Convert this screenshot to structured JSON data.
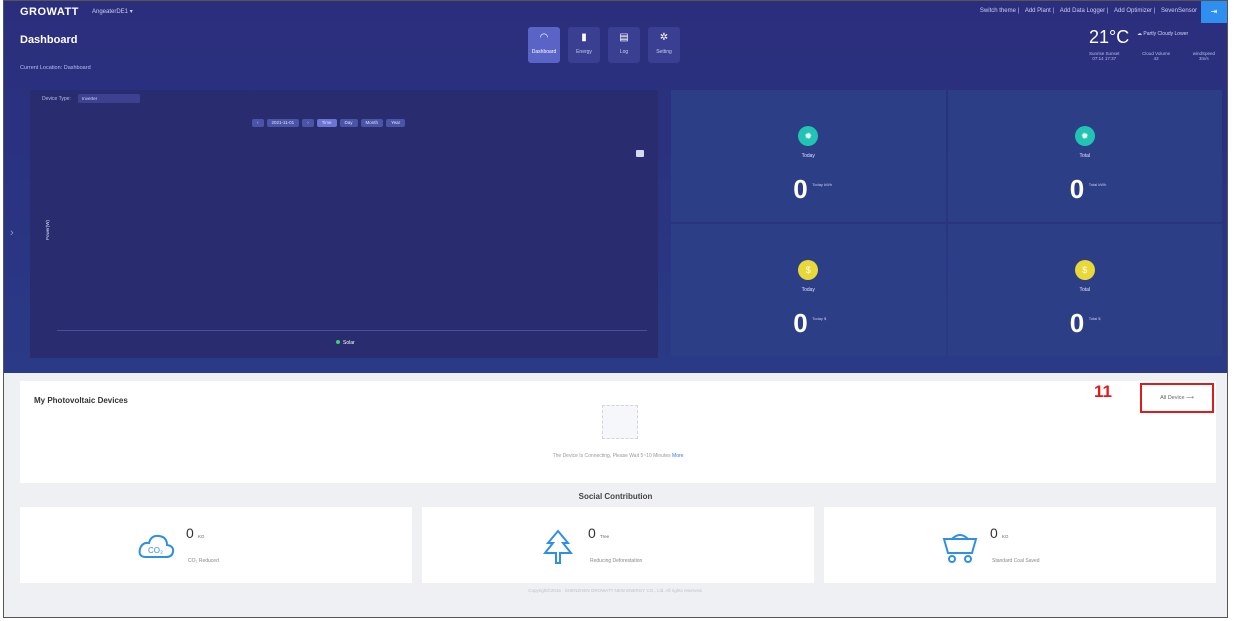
{
  "topbar": {
    "logo": "GROWATT",
    "account": "AngeaterDE1 ▾",
    "links": [
      "Switch theme",
      "Add Plant",
      "Add Data Logger",
      "Add Optimizer",
      "SevenSensor"
    ],
    "exit": "⇥"
  },
  "header": {
    "title": "Dashboard",
    "location": "Current Location: Dashboard"
  },
  "nav": {
    "tabs": [
      {
        "label": "Dashboard",
        "icon": "gauge-icon",
        "glyph": "◠",
        "active": true
      },
      {
        "label": "Energy",
        "icon": "bar-chart-icon",
        "glyph": "▮",
        "active": false
      },
      {
        "label": "Log",
        "icon": "log-icon",
        "glyph": "▤",
        "active": false
      },
      {
        "label": "Setting",
        "icon": "gear-icon",
        "glyph": "✲",
        "active": false
      }
    ]
  },
  "weather": {
    "temp": "21°C",
    "desc": "Partly Cloudy",
    "location": "Lower",
    "meta": [
      {
        "label": "Sunrise Sunset",
        "value": "07:14 17:37"
      },
      {
        "label": "Cloud Volume",
        "value": "42"
      },
      {
        "label": "windSpeed",
        "value": "3m/s"
      }
    ]
  },
  "chart": {
    "device_type_label": "Device Type:",
    "device_type_value": "Inverter",
    "date": "2021-11-01",
    "ranges": [
      "Time",
      "Day",
      "Month",
      "Year"
    ],
    "active_range": "Time",
    "ylabel": "Power(W)",
    "legend": "Solar"
  },
  "chart_data": {
    "type": "line",
    "title": "",
    "ylabel": "Power(W)",
    "series": [
      {
        "name": "Solar",
        "values": []
      }
    ]
  },
  "stats": [
    {
      "label": "Today",
      "value": "0",
      "unit": "Today kWh",
      "icon": "sun-icon",
      "color": "#21c4b3"
    },
    {
      "label": "Total",
      "value": "0",
      "unit": "Total kWh",
      "icon": "sun-icon",
      "color": "#21c4b3"
    },
    {
      "label": "Today",
      "value": "0",
      "unit": "Today $",
      "icon": "coin-icon",
      "color": "#e8d83a"
    },
    {
      "label": "Total",
      "value": "0",
      "unit": "Total $",
      "icon": "coin-icon",
      "color": "#e8d83a"
    }
  ],
  "devices": {
    "title": "My Photovoltaic Devices",
    "all_device": "All Device ⟶",
    "callout": "11",
    "empty_text": "The Device Is Connecting, Please Wait 5~10 Minutes",
    "more": "More"
  },
  "social": {
    "title": "Social Contribution",
    "cards": [
      {
        "value": "0",
        "unit": "KG",
        "label": "CO₂ Reduced",
        "icon": "co2-cloud-icon"
      },
      {
        "value": "0",
        "unit": "Tree",
        "label": "Reducing Deforestation",
        "icon": "tree-icon"
      },
      {
        "value": "0",
        "unit": "KG",
        "label": "Standard Coal Saved",
        "icon": "coal-cart-icon"
      }
    ]
  },
  "footer": {
    "copyright": "Copyright©2015 · SHENZHEN GROWATT NEW ENERGY CO., Ltd. All rights reserved."
  }
}
